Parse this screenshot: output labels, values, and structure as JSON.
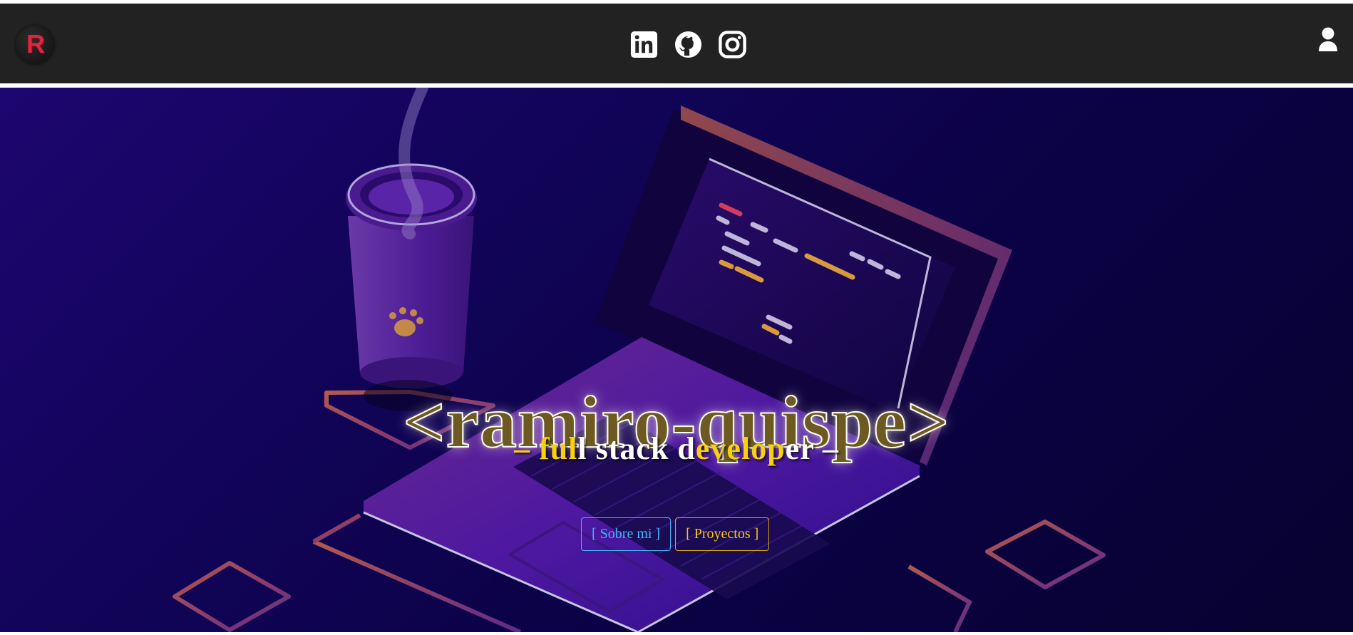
{
  "header": {
    "logo_letter": "R",
    "social_icons": [
      "linkedin-icon",
      "github-icon",
      "instagram-icon"
    ],
    "user_icon": "user-icon"
  },
  "hero": {
    "title": "<ramiro-quispe>",
    "subtitle": {
      "dash_left": "– ",
      "part1_yellow": "ful",
      "part2_white": "l stack d",
      "part3_yellow": "evelop",
      "part4_white": "er –"
    },
    "buttons": {
      "about": "[ Sobre mi ]",
      "projects": "[ Proyectos ]"
    }
  },
  "colors": {
    "navbar": "#222222",
    "accent_yellow": "#f7d10c",
    "accent_blue": "#3fb7f5",
    "logo_red": "#e0263f",
    "hero_bg": "#12045a"
  }
}
